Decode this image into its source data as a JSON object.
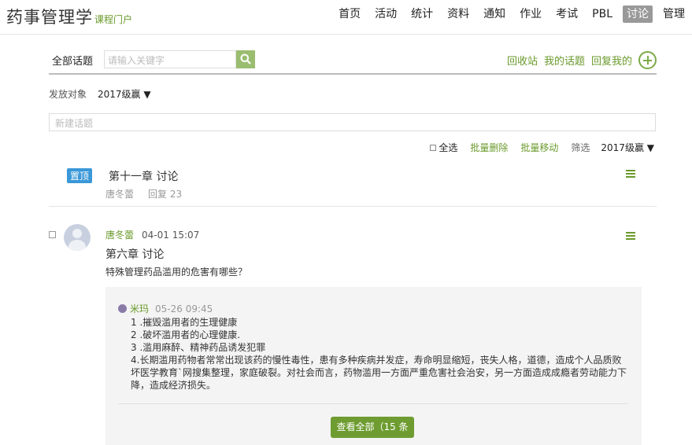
{
  "header": {
    "course_title": "药事管理学",
    "portal_label": "课程门户",
    "nav": [
      {
        "label": "首页",
        "active": false
      },
      {
        "label": "活动",
        "active": false
      },
      {
        "label": "统计",
        "active": false
      },
      {
        "label": "资料",
        "active": false
      },
      {
        "label": "通知",
        "active": false
      },
      {
        "label": "作业",
        "active": false
      },
      {
        "label": "考试",
        "active": false
      },
      {
        "label": "PBL",
        "active": false
      },
      {
        "label": "讨论",
        "active": true
      },
      {
        "label": "管理",
        "active": false
      }
    ]
  },
  "search": {
    "label": "全部话题",
    "placeholder": "请输入关键字",
    "icon": "search-icon"
  },
  "actions": {
    "recycle": "回收站",
    "my_topics": "我的话题",
    "replied_me": "回复我的",
    "add_icon": "plus-circle-icon"
  },
  "target": {
    "label": "发放对象",
    "value": "2017级赢 ▼"
  },
  "new_topic": {
    "placeholder": "新建话题"
  },
  "tools": {
    "select_all": "全选",
    "batch_delete": "批量删除",
    "batch_move": "批量移动",
    "filter": "筛选",
    "filter_value": "2017级赢 ▼"
  },
  "pinned": {
    "badge": "置顶",
    "title": "第十一章 讨论",
    "author": "唐冬蕾",
    "replies": "回复 23"
  },
  "topic": {
    "author": "唐冬蕾",
    "time": "04-01 15:07",
    "title": "第六章 讨论",
    "body": "特殊管理药品滥用的危害有哪些？",
    "reply": {
      "author": "米玛",
      "time": "05-26 09:45",
      "lines": [
        "1 .摧毁滥用者的生理健康",
        "2 .破坏滥用者的心理健康.",
        "3 .滥用麻醉、精神药品诱发犯罪",
        "4.长期滥用药物者常常出现该药的慢性毒性，患有多种疾病并发症，寿命明显缩短，丧失人格，道德，造成个人品质败坏医学教育`网搜集整理，家庭破裂。对社会而言，药物滥用一方面严重危害社会治安，另一方面造成成瘾者劳动能力下降，造成经济损失。"
      ]
    },
    "view_all": "查看全部（15 条"
  },
  "colors": {
    "accent_green": "#6a9a2b",
    "pin_blue": "#3a98d8",
    "active_nav": "#999999"
  }
}
